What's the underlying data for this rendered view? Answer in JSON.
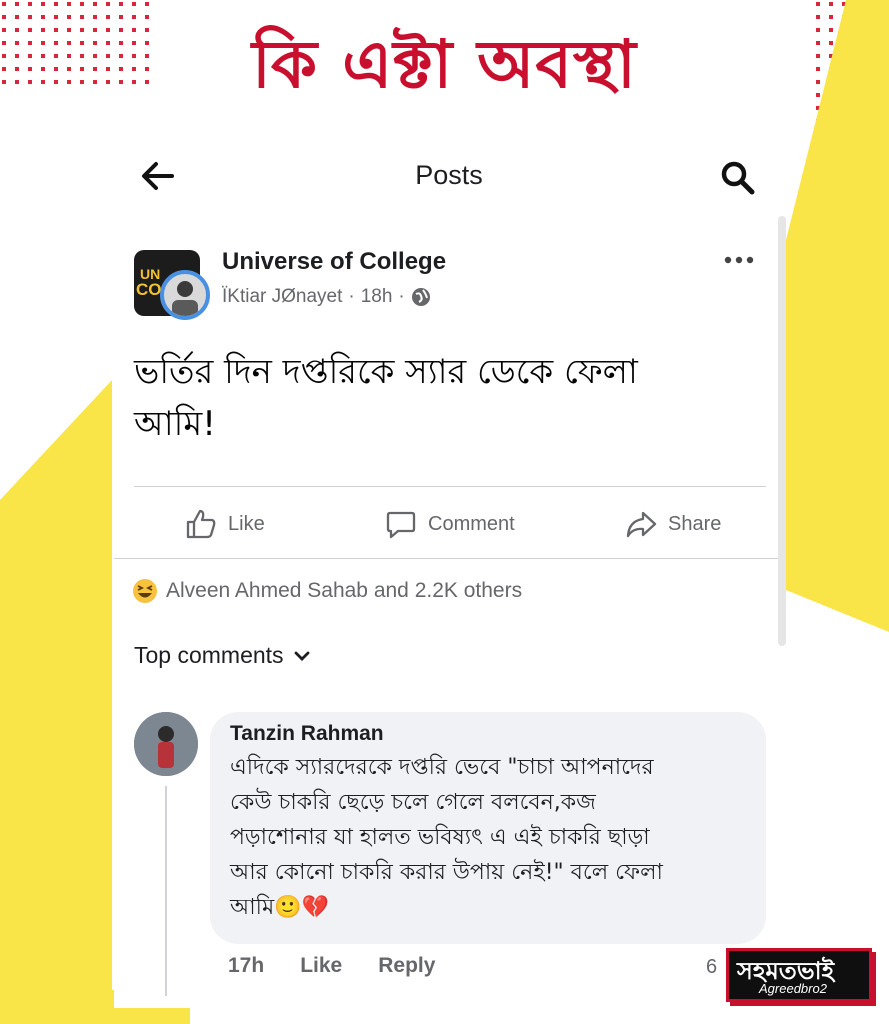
{
  "headline": "কি এক্টা অবস্থা",
  "topbar": {
    "title": "Posts"
  },
  "post": {
    "group_name": "Universe of College",
    "avatar_letters_top": "UN",
    "avatar_letters_bottom": "CO",
    "author": "ÏKtiar JØnayet",
    "separator": "·",
    "time": "18h",
    "text_line1": "ভর্তির দিন দপ্তরিকে স্যার ডেকে ফেলা",
    "text_line2": "আমি!"
  },
  "actions": {
    "like": "Like",
    "comment": "Comment",
    "share": "Share"
  },
  "reactions": {
    "summary": "Alveen Ahmed Sahab and 2.2K others"
  },
  "comments_filter": {
    "label": "Top comments"
  },
  "comment": {
    "name": "Tanzin Rahman",
    "lines": [
      "এদিকে স্যারদেরকে দপ্তরি ভেবে \"চাচা আপনাদের",
      "কেউ চাকরি ছেড়ে চলে গেলে বলবেন,কজ",
      "পড়াশোনার যা হালত ভবিষ্যৎ এ এই চাকরি ছাড়া",
      "আর কোনো চাকরি করার উপায় নেই!\" বলে ফেলা",
      "আমি🙂💔"
    ],
    "time": "17h",
    "like": "Like",
    "reply": "Reply",
    "react_count": "6"
  },
  "watermark": {
    "main": "সহমতভাই",
    "sub": "Agreedbro2"
  },
  "colors": {
    "headline_red": "#c8102e",
    "accent_yellow": "#f9e547",
    "dots_red": "#d9263a",
    "meta_gray": "#65676b",
    "bubble_bg": "#f0f2f5"
  },
  "icons": [
    "back-arrow-icon",
    "search-icon",
    "globe-icon",
    "more-icon",
    "like-icon",
    "comment-icon",
    "share-icon",
    "haha-icon",
    "chevron-down-icon"
  ]
}
